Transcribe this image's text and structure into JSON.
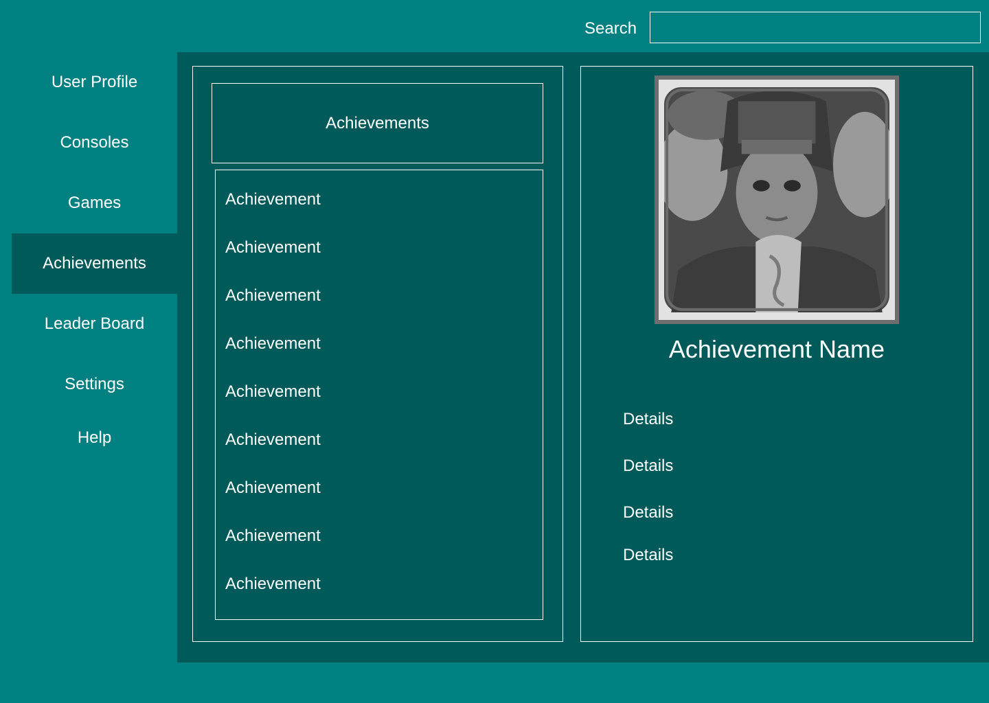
{
  "header": {
    "search_label": "Search",
    "search_value": ""
  },
  "sidebar": {
    "items": [
      {
        "label": "User Profile"
      },
      {
        "label": "Consoles"
      },
      {
        "label": "Games"
      },
      {
        "label": "Achievements",
        "active": true
      },
      {
        "label": "Leader Board"
      },
      {
        "label": "Settings"
      },
      {
        "label": "Help"
      }
    ]
  },
  "list_panel": {
    "header": "Achievements",
    "items": [
      "Achievement",
      "Achievement",
      "Achievement",
      "Achievement",
      "Achievement",
      "Achievement",
      "Achievement",
      "Achievement",
      "Achievement"
    ]
  },
  "detail_panel": {
    "image": "achievement-portrait-icon",
    "name": "Achievement Name",
    "details": [
      "Details",
      "Details",
      "Details",
      "Details"
    ]
  },
  "colors": {
    "background": "#008080",
    "panel": "#005a5a",
    "active_nav": "#005a5a",
    "text": "#ffffff"
  }
}
